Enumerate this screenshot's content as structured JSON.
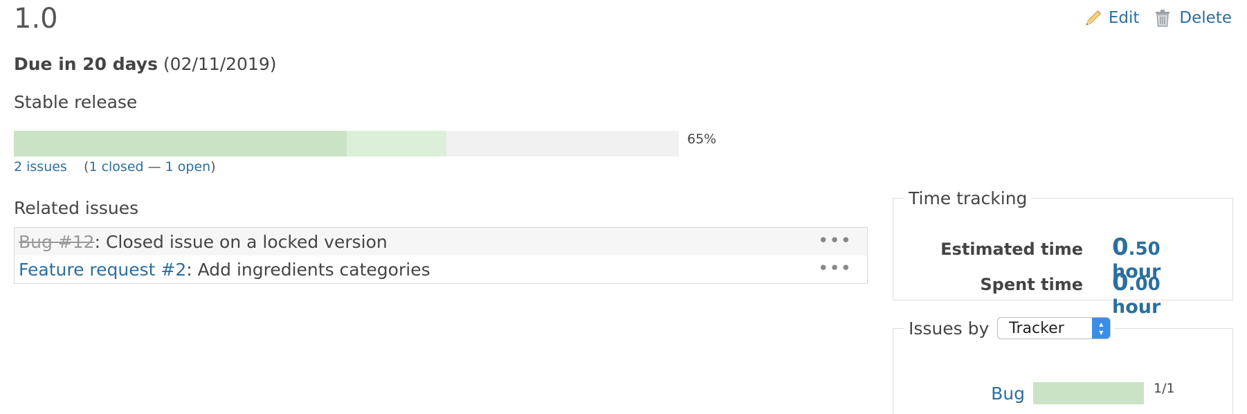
{
  "version": {
    "title": "1.0",
    "due_label": "Due in 20 days",
    "due_date": "(02/11/2019)",
    "description": "Stable release"
  },
  "actions": {
    "edit_label": "Edit",
    "delete_label": "Delete"
  },
  "progress": {
    "closed_fraction": 0.5,
    "done_fraction": 0.65,
    "percent_label": "65%",
    "issues_link": "2 issues",
    "paren_open": "(",
    "closed_link": "1 closed",
    "separator": " — ",
    "open_link": "1 open",
    "paren_close": ")"
  },
  "related": {
    "title": "Related issues",
    "rows": [
      {
        "ref": "Bug #12",
        "subject": ": Closed issue on a locked version",
        "closed": true,
        "more": "•••"
      },
      {
        "ref": "Feature request #2",
        "subject": ": Add ingredients categories",
        "closed": false,
        "more": "•••"
      }
    ]
  },
  "time_tracking": {
    "legend": "Time tracking",
    "estimated_label": "Estimated time",
    "estimated_int": "0",
    "estimated_frac": ".50",
    "spent_label": "Spent time",
    "spent_int": "0",
    "spent_frac": ".00",
    "unit": "hour"
  },
  "issues_by": {
    "legend": "Issues by",
    "selected": "Tracker",
    "rows": [
      {
        "name": "Bug",
        "count": "1/1",
        "fraction": 1.0
      }
    ]
  },
  "colors": {
    "link": "#2a6f9e",
    "progress_closed": "#c9e3c4",
    "progress_done": "#dcefd9",
    "progress_bg": "#f1f1f1"
  },
  "icons": {
    "edit": "pencil-icon",
    "delete": "trash-icon",
    "select": "updown-arrows-icon"
  }
}
